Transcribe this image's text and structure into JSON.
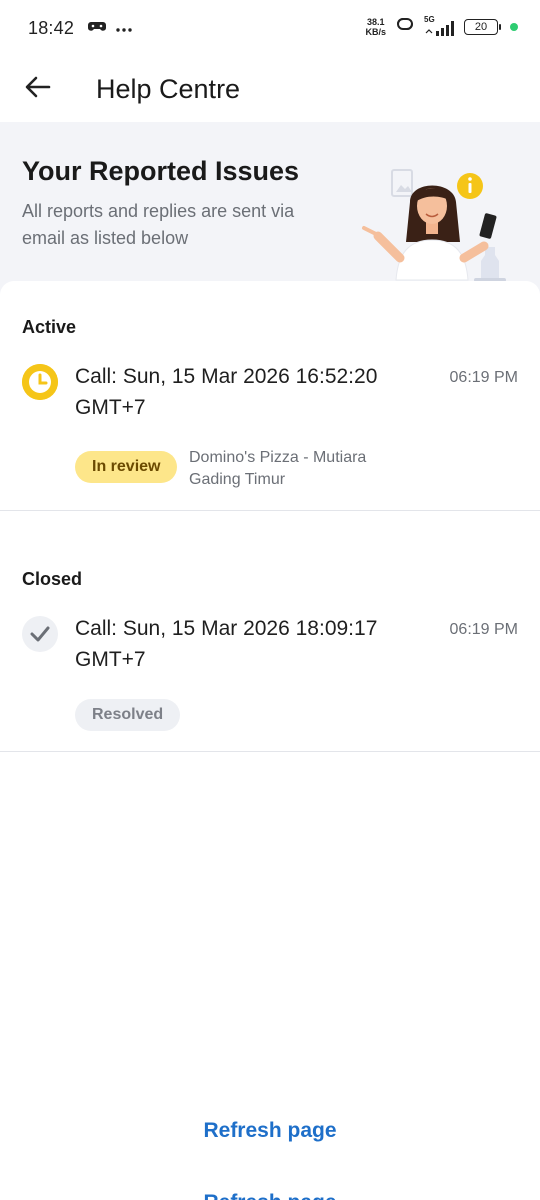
{
  "status_bar": {
    "time": "18:42",
    "net_speed_value": "38.1",
    "net_speed_unit": "KB/s",
    "network_label": "5G",
    "battery": "20",
    "icons": [
      "game-controller-icon",
      "more-dots-icon",
      "hotspot-icon",
      "signal-icon",
      "battery-icon"
    ]
  },
  "app_bar": {
    "title": "Help Centre",
    "back_icon": "arrow-left-icon"
  },
  "banner": {
    "title": "Your Reported Issues",
    "subtitle": "All reports and replies are sent via email as listed below"
  },
  "sections": {
    "active": {
      "label": "Active",
      "issue": {
        "title": "Call: Sun, 15 Mar 2026 16:52:20 GMT+7",
        "time": "06:19 PM",
        "status": "In review",
        "store": "Domino's Pizza - Mutiara Gading Timur",
        "icon": "clock-icon"
      }
    },
    "closed": {
      "label": "Closed",
      "issue": {
        "title": "Call: Sun, 15 Mar 2026 18:09:17 GMT+7",
        "time": "06:19 PM",
        "status": "Resolved",
        "icon": "check-icon"
      }
    }
  },
  "footer": {
    "refresh_label": "Refresh page",
    "refresh_label_2": "Refresh page"
  },
  "colors": {
    "accent": "#1e6fc9",
    "review_pill": "#fde68a",
    "clock": "#f5c518",
    "banner_bg": "#f3f4f8"
  }
}
